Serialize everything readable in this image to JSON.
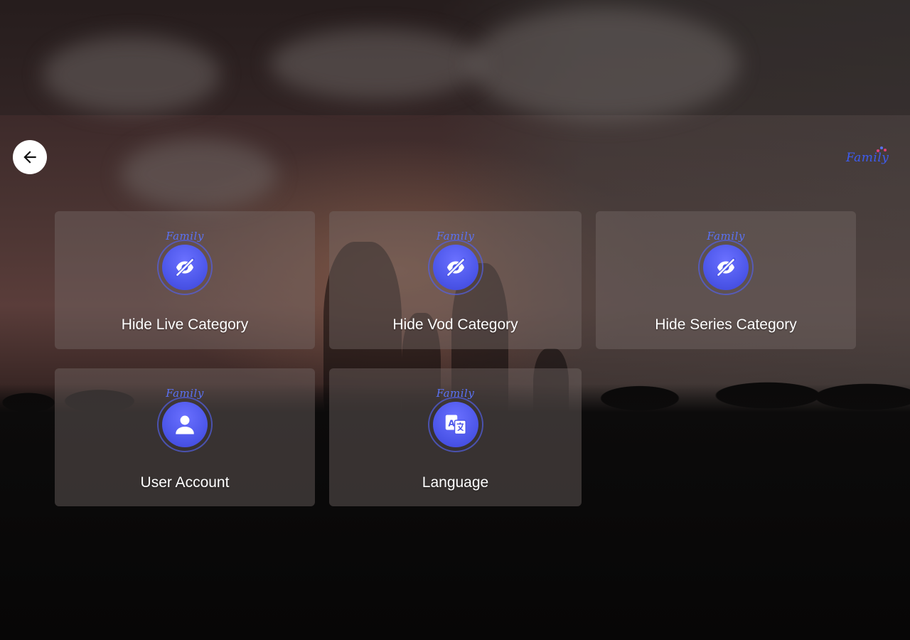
{
  "header": {
    "back_icon": "arrow-left-icon",
    "brand_logo_text": "Family"
  },
  "tiles": [
    {
      "label": "Hide Live Category",
      "icon": "eye-off-icon",
      "badge_text": "Family"
    },
    {
      "label": "Hide Vod Category",
      "icon": "eye-off-icon",
      "badge_text": "Family"
    },
    {
      "label": "Hide Series Category",
      "icon": "eye-off-icon",
      "badge_text": "Family"
    },
    {
      "label": "User Account",
      "icon": "user-icon",
      "badge_text": "Family"
    },
    {
      "label": "Language",
      "icon": "translate-icon",
      "badge_text": "Family"
    }
  ],
  "colors": {
    "accent": "#4d57ea",
    "brand_text": "#3d5cf0",
    "tile_background": "rgba(118,108,106,0.42)",
    "label_text": "#ffffff"
  }
}
